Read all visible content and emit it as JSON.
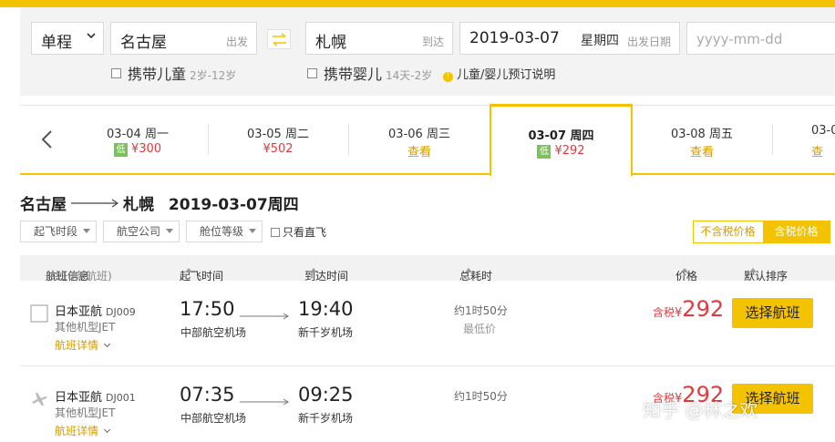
{
  "search": {
    "trip_type": "单程",
    "from_city": "名古屋",
    "from_hint": "出发",
    "to_city": "札幌",
    "to_hint": "到达",
    "depart_date": "2019-03-07",
    "depart_weekday": "星期四",
    "depart_hint": "出发日期",
    "return_placeholder": "yyyy-mm-dd",
    "child_label": "携带儿童",
    "child_age": "2岁-12岁",
    "infant_label": "携带婴儿",
    "infant_age": "14天-2岁",
    "booking_note": "儿童/婴儿预订说明"
  },
  "dates": [
    {
      "date": "03-04 周一",
      "low": "低",
      "price": "¥300"
    },
    {
      "date": "03-05 周二",
      "low": "",
      "price": "¥502"
    },
    {
      "date": "03-06 周三",
      "low": "",
      "price": "查看"
    },
    {
      "date": "03-07 周四",
      "low": "低",
      "price": "¥292"
    },
    {
      "date": "03-08 周五",
      "low": "",
      "price": "查看"
    },
    {
      "date": "03-0",
      "low": "",
      "price": "查"
    }
  ],
  "route": {
    "from": "名古屋",
    "to": "札幌",
    "date": "2019-03-07周四"
  },
  "filters": {
    "time": "起飞时段",
    "airline": "航空公司",
    "cabin": "舱位等级",
    "direct": "只看直飞"
  },
  "tax": {
    "excluded": "不含税价格",
    "included": "含税价格"
  },
  "table_header": {
    "flight_info": "航班信息",
    "count": "(共18条航班)",
    "depart": "起飞时间",
    "arrive": "到达时间",
    "duration": "总耗时",
    "price": "价格",
    "sort": "默认排序"
  },
  "flights": [
    {
      "airline": "日本亚航",
      "flight_no": "DJ009",
      "model": "其他机型JET",
      "details": "航班详情",
      "dep_time": "17:50",
      "dep_airport": "中部航空机场",
      "arr_time": "19:40",
      "arr_airport": "新千岁机场",
      "duration": "约1时50分",
      "tag": "最低价",
      "tax_label": "含税",
      "currency": "¥",
      "price": "292",
      "select": "选择航班"
    },
    {
      "airline": "日本亚航",
      "flight_no": "DJ001",
      "model": "其他机型JET",
      "details": "航班详情",
      "dep_time": "07:35",
      "dep_airport": "中部航空机场",
      "arr_time": "09:25",
      "arr_airport": "新千岁机场",
      "duration": "约1时50分",
      "tag": "",
      "tax_label": "含税",
      "currency": "¥",
      "price": "292",
      "select": "选择航班"
    }
  ],
  "watermark": "知乎 @林之欢",
  "colors": {
    "accent": "#f4c300",
    "price": "#e4393c",
    "low_badge": "#7cc25c"
  }
}
